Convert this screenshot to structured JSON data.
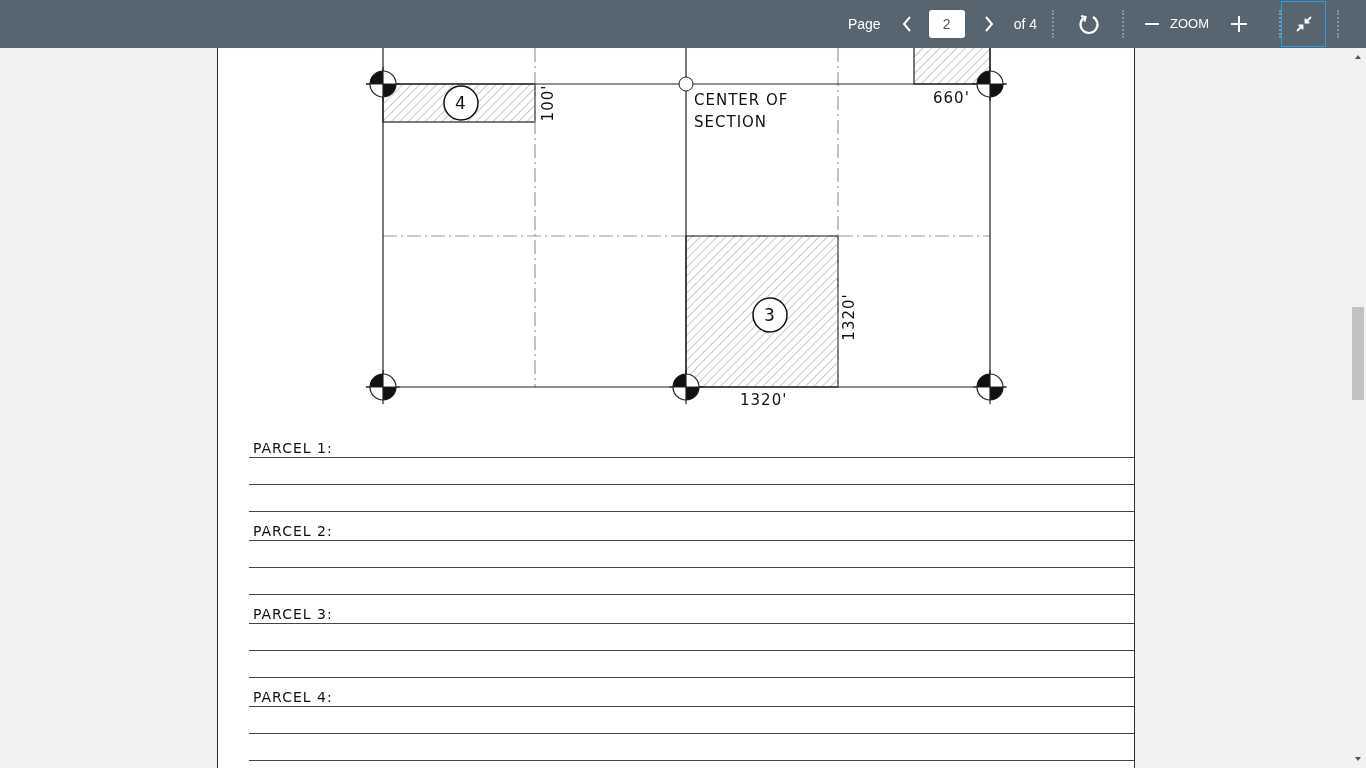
{
  "toolbar": {
    "page_label": "Page",
    "page_value": "2",
    "page_count": "of 4",
    "zoom_label": "ZOOM",
    "fit_button": {
      "selected": true
    }
  },
  "drawing": {
    "labels": [
      {
        "kind": "parcel-number",
        "text": "4"
      },
      {
        "kind": "dimension",
        "text": "100'"
      },
      {
        "kind": "note",
        "text": "CENTER OF"
      },
      {
        "kind": "dimension",
        "text": "660'"
      },
      {
        "kind": "note",
        "text": "SECTION"
      },
      {
        "kind": "parcel-number",
        "text": "3"
      },
      {
        "kind": "dimension",
        "text": "1320'"
      },
      {
        "kind": "dimension",
        "text": "1320'"
      }
    ]
  },
  "parcels": [
    {
      "label": "PARCEL 1:"
    },
    {
      "label": "PARCEL 2:"
    },
    {
      "label": "PARCEL 3:"
    },
    {
      "label": "PARCEL 4:"
    }
  ]
}
